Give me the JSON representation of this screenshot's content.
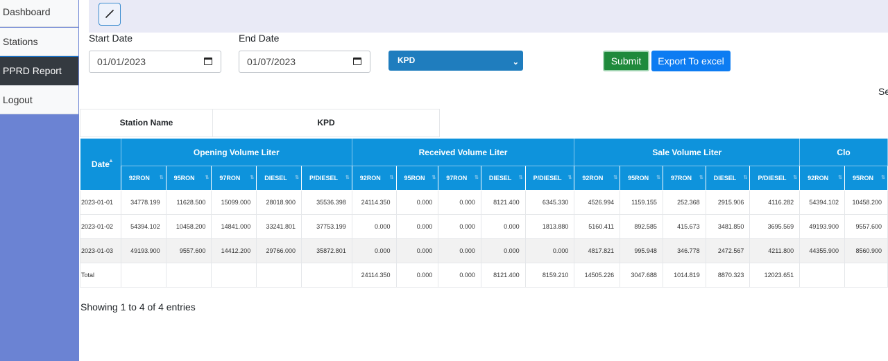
{
  "sidebar": {
    "items": [
      {
        "label": "Dashboard"
      },
      {
        "label": "Stations"
      },
      {
        "label": "PPRD Report"
      },
      {
        "label": "Logout"
      }
    ]
  },
  "filters": {
    "start_label": "Start Date",
    "start_value": "01/01/2023",
    "end_label": "End Date",
    "end_value": "01/07/2023",
    "station_selected": "KPD",
    "submit_label": "Submit",
    "export_label": "Export To excel",
    "search_fragment": "Se"
  },
  "station": {
    "name_label": "Station Name",
    "name_value": "KPD"
  },
  "table": {
    "date_header": "Date",
    "groups": [
      "Opening Volume Liter",
      "Received Volume Liter",
      "Sale Volume Liter",
      "Clo"
    ],
    "subheaders": [
      "92RON",
      "95RON",
      "97RON",
      "DIESEL",
      "P/DIESEL",
      "92RON",
      "95RON",
      "97RON",
      "DIESEL",
      "P/DIESEL",
      "92RON",
      "95RON",
      "97RON",
      "DIESEL",
      "P/DIESEL",
      "92RON",
      "95RON"
    ],
    "rows": [
      [
        "2023-01-01",
        "34778.199",
        "11628.500",
        "15099.000",
        "28018.900",
        "35536.398",
        "24114.350",
        "0.000",
        "0.000",
        "8121.400",
        "6345.330",
        "4526.994",
        "1159.155",
        "252.368",
        "2915.906",
        "4116.282",
        "54394.102",
        "10458.200"
      ],
      [
        "2023-01-02",
        "54394.102",
        "10458.200",
        "14841.000",
        "33241.801",
        "37753.199",
        "0.000",
        "0.000",
        "0.000",
        "0.000",
        "1813.880",
        "5160.411",
        "892.585",
        "415.673",
        "3481.850",
        "3695.569",
        "49193.900",
        "9557.600"
      ],
      [
        "2023-01-03",
        "49193.900",
        "9557.600",
        "14412.200",
        "29766.000",
        "35872.801",
        "0.000",
        "0.000",
        "0.000",
        "0.000",
        "0.000",
        "4817.821",
        "995.948",
        "346.778",
        "2472.567",
        "4211.800",
        "44355.900",
        "8560.900"
      ],
      [
        "Total",
        "",
        "",
        "",
        "",
        "",
        "24114.350",
        "0.000",
        "0.000",
        "8121.400",
        "8159.210",
        "14505.226",
        "3047.688",
        "1014.819",
        "8870.323",
        "12023.651",
        "",
        ""
      ]
    ]
  },
  "footer": {
    "showing": "Showing 1 to 4 of 4 entries"
  }
}
